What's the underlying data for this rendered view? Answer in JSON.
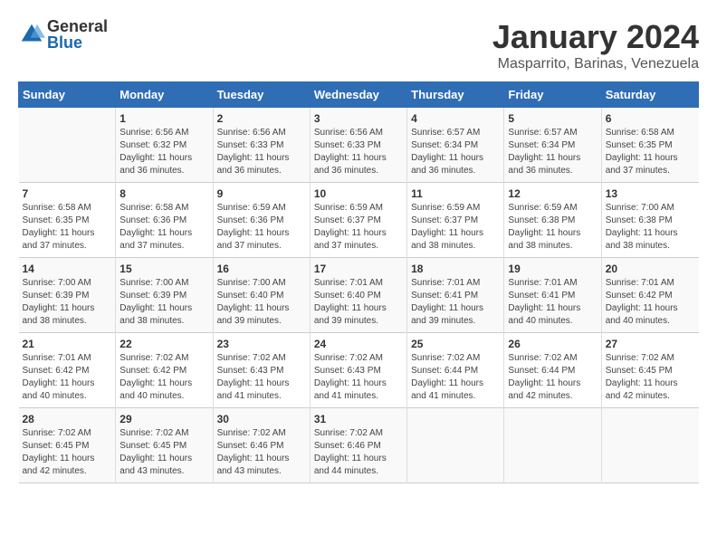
{
  "logo": {
    "general": "General",
    "blue": "Blue"
  },
  "title": "January 2024",
  "subtitle": "Masparrito, Barinas, Venezuela",
  "days_of_week": [
    "Sunday",
    "Monday",
    "Tuesday",
    "Wednesday",
    "Thursday",
    "Friday",
    "Saturday"
  ],
  "weeks": [
    [
      {
        "day": "",
        "sunrise": "",
        "sunset": "",
        "daylight": ""
      },
      {
        "day": "1",
        "sunrise": "Sunrise: 6:56 AM",
        "sunset": "Sunset: 6:32 PM",
        "daylight": "Daylight: 11 hours and 36 minutes."
      },
      {
        "day": "2",
        "sunrise": "Sunrise: 6:56 AM",
        "sunset": "Sunset: 6:33 PM",
        "daylight": "Daylight: 11 hours and 36 minutes."
      },
      {
        "day": "3",
        "sunrise": "Sunrise: 6:56 AM",
        "sunset": "Sunset: 6:33 PM",
        "daylight": "Daylight: 11 hours and 36 minutes."
      },
      {
        "day": "4",
        "sunrise": "Sunrise: 6:57 AM",
        "sunset": "Sunset: 6:34 PM",
        "daylight": "Daylight: 11 hours and 36 minutes."
      },
      {
        "day": "5",
        "sunrise": "Sunrise: 6:57 AM",
        "sunset": "Sunset: 6:34 PM",
        "daylight": "Daylight: 11 hours and 36 minutes."
      },
      {
        "day": "6",
        "sunrise": "Sunrise: 6:58 AM",
        "sunset": "Sunset: 6:35 PM",
        "daylight": "Daylight: 11 hours and 37 minutes."
      }
    ],
    [
      {
        "day": "7",
        "sunrise": "Sunrise: 6:58 AM",
        "sunset": "Sunset: 6:35 PM",
        "daylight": "Daylight: 11 hours and 37 minutes."
      },
      {
        "day": "8",
        "sunrise": "Sunrise: 6:58 AM",
        "sunset": "Sunset: 6:36 PM",
        "daylight": "Daylight: 11 hours and 37 minutes."
      },
      {
        "day": "9",
        "sunrise": "Sunrise: 6:59 AM",
        "sunset": "Sunset: 6:36 PM",
        "daylight": "Daylight: 11 hours and 37 minutes."
      },
      {
        "day": "10",
        "sunrise": "Sunrise: 6:59 AM",
        "sunset": "Sunset: 6:37 PM",
        "daylight": "Daylight: 11 hours and 37 minutes."
      },
      {
        "day": "11",
        "sunrise": "Sunrise: 6:59 AM",
        "sunset": "Sunset: 6:37 PM",
        "daylight": "Daylight: 11 hours and 38 minutes."
      },
      {
        "day": "12",
        "sunrise": "Sunrise: 6:59 AM",
        "sunset": "Sunset: 6:38 PM",
        "daylight": "Daylight: 11 hours and 38 minutes."
      },
      {
        "day": "13",
        "sunrise": "Sunrise: 7:00 AM",
        "sunset": "Sunset: 6:38 PM",
        "daylight": "Daylight: 11 hours and 38 minutes."
      }
    ],
    [
      {
        "day": "14",
        "sunrise": "Sunrise: 7:00 AM",
        "sunset": "Sunset: 6:39 PM",
        "daylight": "Daylight: 11 hours and 38 minutes."
      },
      {
        "day": "15",
        "sunrise": "Sunrise: 7:00 AM",
        "sunset": "Sunset: 6:39 PM",
        "daylight": "Daylight: 11 hours and 38 minutes."
      },
      {
        "day": "16",
        "sunrise": "Sunrise: 7:00 AM",
        "sunset": "Sunset: 6:40 PM",
        "daylight": "Daylight: 11 hours and 39 minutes."
      },
      {
        "day": "17",
        "sunrise": "Sunrise: 7:01 AM",
        "sunset": "Sunset: 6:40 PM",
        "daylight": "Daylight: 11 hours and 39 minutes."
      },
      {
        "day": "18",
        "sunrise": "Sunrise: 7:01 AM",
        "sunset": "Sunset: 6:41 PM",
        "daylight": "Daylight: 11 hours and 39 minutes."
      },
      {
        "day": "19",
        "sunrise": "Sunrise: 7:01 AM",
        "sunset": "Sunset: 6:41 PM",
        "daylight": "Daylight: 11 hours and 40 minutes."
      },
      {
        "day": "20",
        "sunrise": "Sunrise: 7:01 AM",
        "sunset": "Sunset: 6:42 PM",
        "daylight": "Daylight: 11 hours and 40 minutes."
      }
    ],
    [
      {
        "day": "21",
        "sunrise": "Sunrise: 7:01 AM",
        "sunset": "Sunset: 6:42 PM",
        "daylight": "Daylight: 11 hours and 40 minutes."
      },
      {
        "day": "22",
        "sunrise": "Sunrise: 7:02 AM",
        "sunset": "Sunset: 6:42 PM",
        "daylight": "Daylight: 11 hours and 40 minutes."
      },
      {
        "day": "23",
        "sunrise": "Sunrise: 7:02 AM",
        "sunset": "Sunset: 6:43 PM",
        "daylight": "Daylight: 11 hours and 41 minutes."
      },
      {
        "day": "24",
        "sunrise": "Sunrise: 7:02 AM",
        "sunset": "Sunset: 6:43 PM",
        "daylight": "Daylight: 11 hours and 41 minutes."
      },
      {
        "day": "25",
        "sunrise": "Sunrise: 7:02 AM",
        "sunset": "Sunset: 6:44 PM",
        "daylight": "Daylight: 11 hours and 41 minutes."
      },
      {
        "day": "26",
        "sunrise": "Sunrise: 7:02 AM",
        "sunset": "Sunset: 6:44 PM",
        "daylight": "Daylight: 11 hours and 42 minutes."
      },
      {
        "day": "27",
        "sunrise": "Sunrise: 7:02 AM",
        "sunset": "Sunset: 6:45 PM",
        "daylight": "Daylight: 11 hours and 42 minutes."
      }
    ],
    [
      {
        "day": "28",
        "sunrise": "Sunrise: 7:02 AM",
        "sunset": "Sunset: 6:45 PM",
        "daylight": "Daylight: 11 hours and 42 minutes."
      },
      {
        "day": "29",
        "sunrise": "Sunrise: 7:02 AM",
        "sunset": "Sunset: 6:45 PM",
        "daylight": "Daylight: 11 hours and 43 minutes."
      },
      {
        "day": "30",
        "sunrise": "Sunrise: 7:02 AM",
        "sunset": "Sunset: 6:46 PM",
        "daylight": "Daylight: 11 hours and 43 minutes."
      },
      {
        "day": "31",
        "sunrise": "Sunrise: 7:02 AM",
        "sunset": "Sunset: 6:46 PM",
        "daylight": "Daylight: 11 hours and 44 minutes."
      },
      {
        "day": "",
        "sunrise": "",
        "sunset": "",
        "daylight": ""
      },
      {
        "day": "",
        "sunrise": "",
        "sunset": "",
        "daylight": ""
      },
      {
        "day": "",
        "sunrise": "",
        "sunset": "",
        "daylight": ""
      }
    ]
  ]
}
